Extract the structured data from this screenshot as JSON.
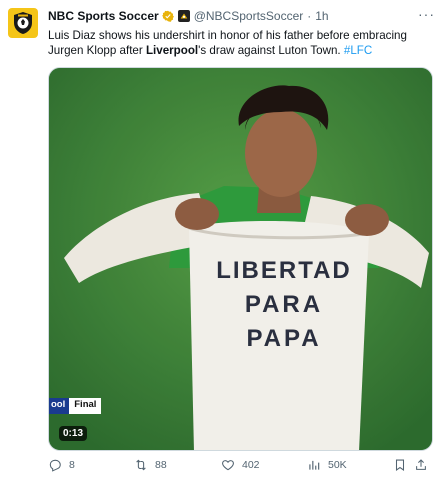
{
  "tweet": {
    "author_name": "NBC Sports Soccer",
    "handle": "@NBCSportsSoccer",
    "separator": "·",
    "time": "1h",
    "text_parts": {
      "part1": "Luis Diaz shows his undershirt in honor of his father before embracing Jurgen Klopp after ",
      "bold": "Liverpool",
      "part2": "'s draw against Luton Town. ",
      "hashtag": "#LFC"
    },
    "more_label": "···"
  },
  "media": {
    "shirt_text": [
      "LIBERTAD",
      "PARA",
      "PAPA"
    ],
    "scoreboard": {
      "team": "ool",
      "status": "Final"
    },
    "duration": "0:13"
  },
  "actions": {
    "replies": "8",
    "reposts": "88",
    "likes": "402",
    "views": "50K"
  },
  "colors": {
    "accent": "#1d9bf0",
    "verified_gold": "#e8b30b",
    "muted_text": "#536471"
  },
  "icons": {
    "avatar": "nbc-sports-logo-icon",
    "verified": "verified-gold-badge-icon",
    "org_badge": "nbc-affiliate-badge-icon",
    "reply": "reply-icon",
    "repost": "repost-icon",
    "like": "heart-icon",
    "views": "views-chart-icon",
    "bookmark": "bookmark-icon",
    "share": "share-icon"
  }
}
